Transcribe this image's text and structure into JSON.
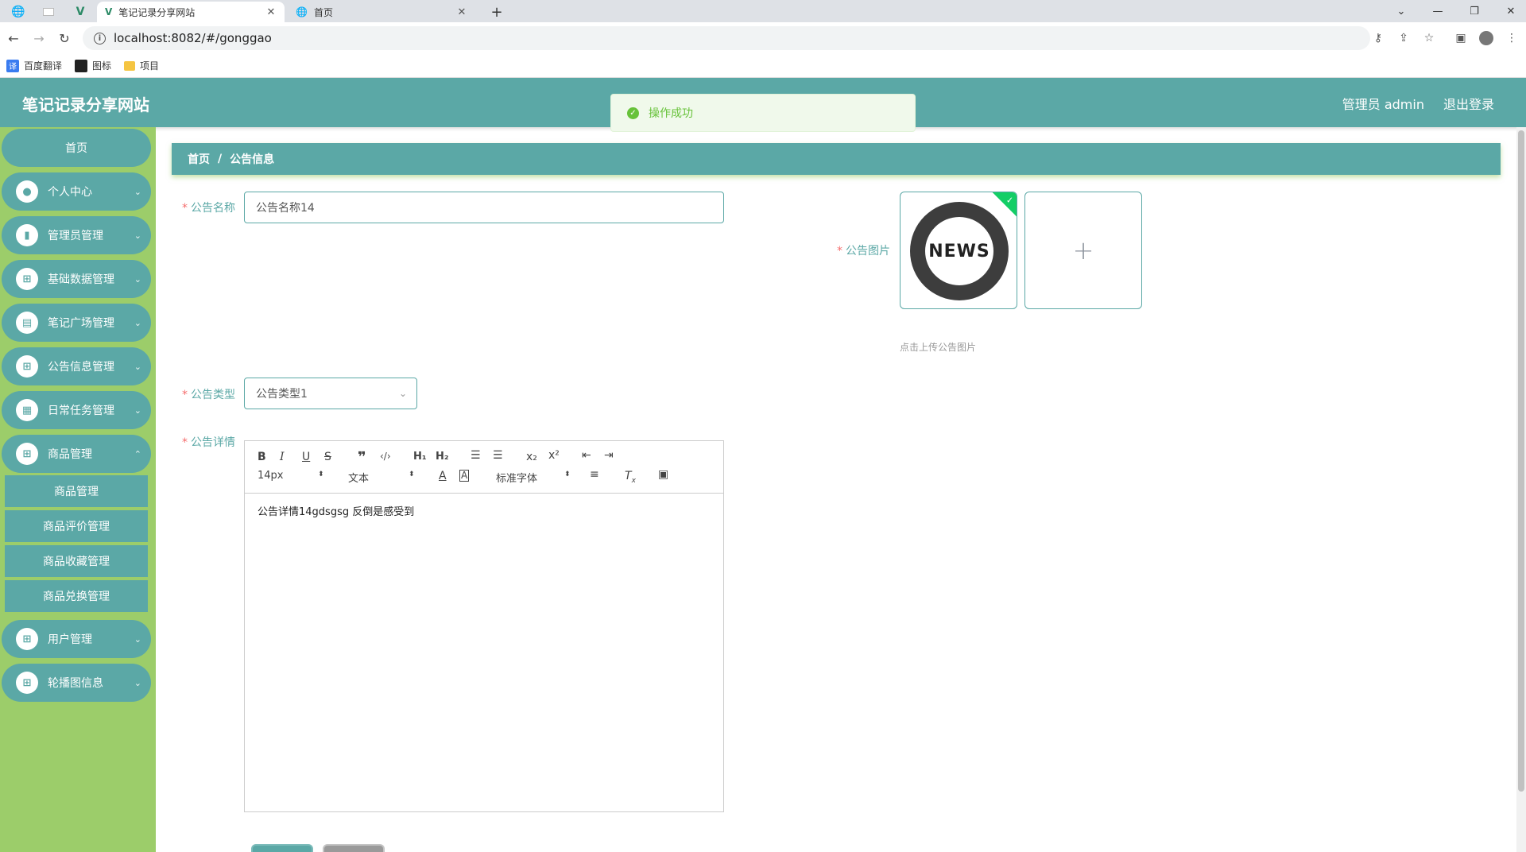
{
  "browser": {
    "tabs": [
      {
        "title": "笔记记录分享网站",
        "active": true
      },
      {
        "title": "首页",
        "active": false
      }
    ],
    "url": "localhost:8082/#/gonggao",
    "bookmarks": [
      "百度翻译",
      "图标",
      "项目"
    ]
  },
  "header": {
    "site_title": "笔记记录分享网站",
    "user_label": "管理员 admin",
    "logout_label": "退出登录"
  },
  "toast": {
    "message": "操作成功"
  },
  "sidebar": {
    "home": "首页",
    "items": [
      {
        "label": "个人中心",
        "icon": "user-icon"
      },
      {
        "label": "管理员管理",
        "icon": "chart-icon"
      },
      {
        "label": "基础数据管理",
        "icon": "grid-icon"
      },
      {
        "label": "笔记广场管理",
        "icon": "briefcase-icon"
      },
      {
        "label": "公告信息管理",
        "icon": "grid-icon"
      },
      {
        "label": "日常任务管理",
        "icon": "clipboard-icon"
      },
      {
        "label": "商品管理",
        "icon": "grid-icon"
      },
      {
        "label": "用户管理",
        "icon": "grid-icon"
      },
      {
        "label": "轮播图信息",
        "icon": "grid-icon"
      }
    ],
    "sub_items": [
      "商品管理",
      "商品评价管理",
      "商品收藏管理",
      "商品兑换管理"
    ]
  },
  "breadcrumb": {
    "home": "首页",
    "separator": "/",
    "current": "公告信息"
  },
  "form": {
    "name_label": "公告名称",
    "name_value": "公告名称14",
    "image_label": "公告图片",
    "image_text": "NEWS",
    "upload_hint": "点击上传公告图片",
    "type_label": "公告类型",
    "type_value": "公告类型1",
    "detail_label": "公告详情",
    "detail_content": "公告详情14gdsgsg 反倒是感受到"
  },
  "editor": {
    "font_size": "14px",
    "block_format": "文本",
    "font_family": "标准字体"
  },
  "colors": {
    "primary": "#5ba8a6",
    "sidebar_bg": "#9ccd6a",
    "success": "#67c23a",
    "required": "#f56c6c"
  }
}
